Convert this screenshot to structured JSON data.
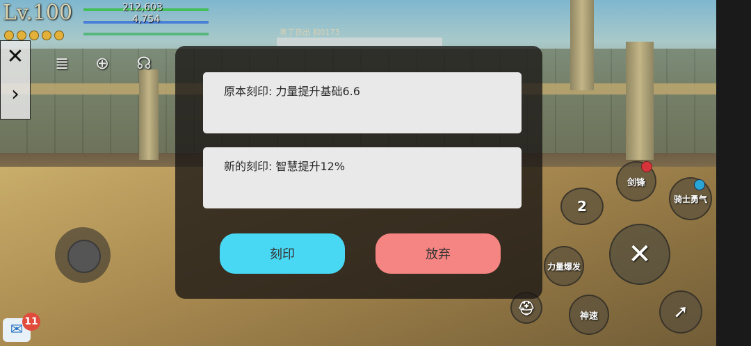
{
  "hud": {
    "level": "Lv.100",
    "hp": "212,603",
    "mp": "4,754"
  },
  "target": {
    "name": "黄丁自出 和0173",
    "value": "0"
  },
  "dialog": {
    "original_inscription": "原本刻印: 力量提升基础6.6",
    "new_inscription": "新的刻印: 智慧提升12%",
    "inscribe_label": "刻印",
    "abandon_label": "放弃"
  },
  "skills": {
    "sword": "剑锋",
    "knight_courage": "骑士勇气",
    "power_burst": "力量爆发",
    "speed": "神速",
    "slot_number": "2"
  },
  "chat": {
    "unread_count": "11"
  },
  "colors": {
    "inscribe_button": "#49d8f4",
    "abandon_button": "#f58582",
    "hp_bar": "#44c05b",
    "mp_bar": "#4a7fd8"
  }
}
